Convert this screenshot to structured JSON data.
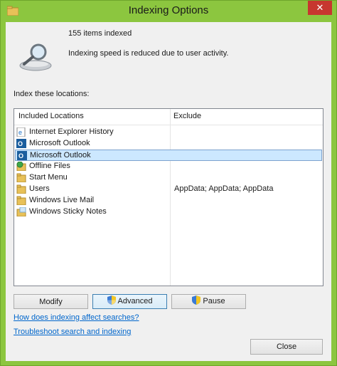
{
  "window": {
    "title": "Indexing Options",
    "close_glyph": "✕"
  },
  "status": {
    "items_indexed": "155 items indexed",
    "speed_message": "Indexing speed is reduced due to user activity."
  },
  "locations": {
    "section_label": "Index these locations:",
    "col_included": "Included Locations",
    "col_exclude": "Exclude",
    "rows": [
      {
        "label": "Internet Explorer History",
        "exclude": "",
        "icon": "ie-history-icon"
      },
      {
        "label": "Microsoft Outlook",
        "exclude": "",
        "icon": "outlook-icon"
      },
      {
        "label": "Microsoft Outlook",
        "exclude": "",
        "icon": "outlook-icon",
        "selected": true
      },
      {
        "label": "Offline Files",
        "exclude": "",
        "icon": "offline-files-icon"
      },
      {
        "label": "Start Menu",
        "exclude": "",
        "icon": "folder-icon"
      },
      {
        "label": "Users",
        "exclude": "AppData; AppData; AppData",
        "icon": "folder-icon"
      },
      {
        "label": "Windows Live Mail",
        "exclude": "",
        "icon": "folder-icon"
      },
      {
        "label": "Windows Sticky Notes",
        "exclude": "",
        "icon": "sticky-notes-icon"
      }
    ]
  },
  "buttons": {
    "modify": "Modify",
    "advanced": "Advanced",
    "pause": "Pause",
    "close": "Close"
  },
  "links": {
    "how_indexing": "How does indexing affect searches?",
    "troubleshoot": "Troubleshoot search and indexing"
  },
  "colors": {
    "titlebar": "#8cc63f",
    "close_button": "#c7372f",
    "selection": "#cce8ff",
    "link": "#0066cc"
  }
}
